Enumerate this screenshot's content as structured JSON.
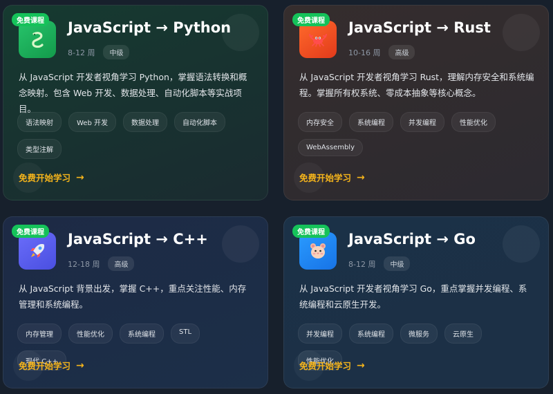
{
  "colors": {
    "page_bg": "#17202c",
    "badge_bg": "#15c25a",
    "cta_color": "#f5b41b"
  },
  "cards": [
    {
      "badge": "免费课程",
      "title": "JavaScript → Python",
      "weeks": "8-12 周",
      "level": "中级",
      "icon": "python-snake-icon",
      "description": "从 JavaScript 开发者视角学习 Python，掌握语法转换和概念映射。包含 Web 开发、数据处理、自动化脚本等实战项目。",
      "tags": [
        "语法映射",
        "Web 开发",
        "数据处理",
        "自动化脚本",
        "类型注解"
      ],
      "cta": "免费开始学习"
    },
    {
      "badge": "免费课程",
      "title": "JavaScript → Rust",
      "weeks": "10-16 周",
      "level": "高级",
      "icon": "crab-icon",
      "description": "从 JavaScript 开发者视角学习 Rust，理解内存安全和系统编程。掌握所有权系统、零成本抽象等核心概念。",
      "tags": [
        "内存安全",
        "系统编程",
        "并发编程",
        "性能优化",
        "WebAssembly"
      ],
      "cta": "免费开始学习"
    },
    {
      "badge": "免费课程",
      "title": "JavaScript → C++",
      "weeks": "12-18 周",
      "level": "高级",
      "icon": "rocket-icon",
      "description": "从 JavaScript 背景出发，掌握 C++，重点关注性能、内存管理和系统编程。",
      "tags": [
        "内存管理",
        "性能优化",
        "系统编程",
        "STL",
        "现代 C++"
      ],
      "cta": "免费开始学习"
    },
    {
      "badge": "免费课程",
      "title": "JavaScript → Go",
      "weeks": "8-12 周",
      "level": "中级",
      "icon": "hamster-icon",
      "description": "从 JavaScript 开发者视角学习 Go，重点掌握并发编程、系统编程和云原生开发。",
      "tags": [
        "并发编程",
        "系统编程",
        "微服务",
        "云原生",
        "性能优化"
      ],
      "cta": "免费开始学习"
    }
  ]
}
